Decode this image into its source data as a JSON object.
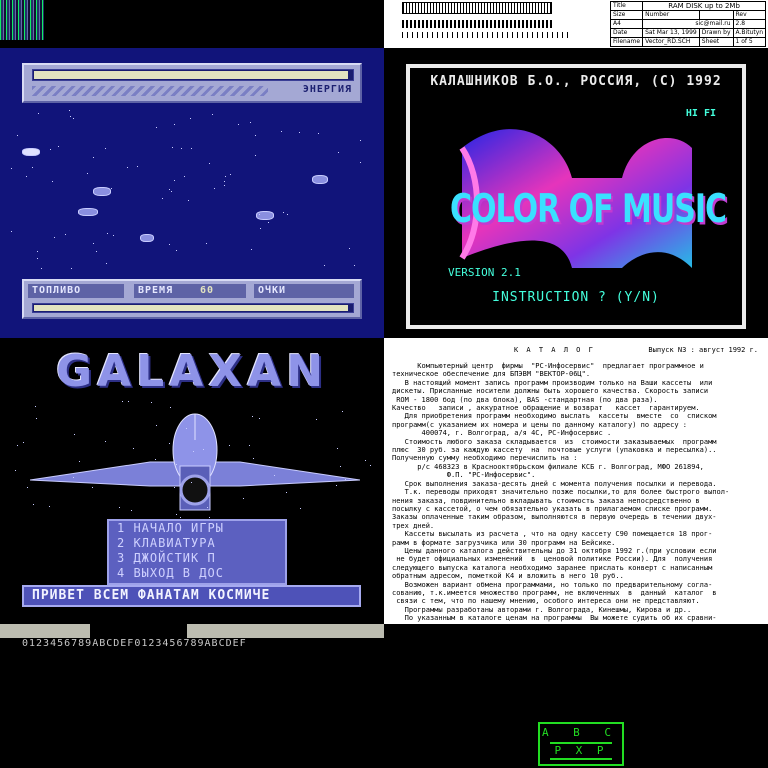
{
  "schematic": {
    "title_label": "Title",
    "title_value": "RAM DISK up to 2Mb",
    "size_label": "Size",
    "number_label": "Number",
    "rev_label": "Rev",
    "size_value": "A4",
    "number_value": "sic@mail.ru",
    "rev_value": "2.8",
    "date_label": "Date",
    "date_value": "Sat Mar 13, 1999",
    "drawn_label": "Drawn by",
    "drawn_value": "A.Bitutyn",
    "file_label": "Filename",
    "file_value": "Vector_RD.SCH",
    "sheet_label": "Sheet",
    "sheet_value": "1 of 5"
  },
  "game": {
    "energy_label": "ЭНЕРГИЯ",
    "fuel_label": "ТОПЛИВО",
    "time_label": "ВРЕМЯ",
    "time_value": "60",
    "score_label": "ОЧКИ",
    "energy_level": 0.98,
    "fuel_level": 0.98
  },
  "music": {
    "credit": "КАЛАШНИКОВ Б.О., РОССИЯ, (С) 1992",
    "hifi": "HI FI",
    "logo": "COLOR OF MUSIC",
    "version": "VERSION 2.1",
    "instruction": "INSTRUCTION ? (Y/N)"
  },
  "galaxan": {
    "title": "GALAXAN",
    "menu": [
      "1 НАЧАЛО ИГРЫ",
      "2 КЛАВИАТУРА",
      "3 ДЖОЙСТИК П",
      "4 ВЫХОД В ДОС"
    ],
    "ticker": "ПРИВЕТ ВСЕМ ФАНАТАМ КОСМИЧЕ"
  },
  "font_strip": "0123456789ABCDEF0123456789ABCDEF",
  "catalog": {
    "heading": "К А Т А Л О Г",
    "issue": "Выпуск N3 : август 1992 г.",
    "body": "      Компьютерный центр  фирмы  \"РС-Инфосервис\"  предлагает программное и\nтехническое обеспечение для БПЭВМ \"ВЕКТОР-06Ц\".\n   В настоящий момент запись программ производим только на Ваши кассеты  или\nдискеты. Присланные носители должны быть хорошего качества. Скорость записи\n ROM - 1800 бод (по два блока), BAS -стандартная (по два раза).\nКачество   записи , аккуратное обращение и возврат   кассет  гарантируем.\n   Для приобретения программ необходимо выслать  кассеты  вместе  со  списком\nпрограмм(с указанием их номера и цены по данному каталогу) по адресу :\n       400074, г. Волгоград, а/я 4С, РС-Инфосервис .\n   Стоимость любого заказа складывается  из  стоимости заказываемых  программ\nплюс  30 руб. за каждую кассету  на  почтовые услуги (упаковка и пересылка)..\nПолученную сумму необходимо перечислить на :\n      р/с 468323 в Краснооктябрьском филиале КСБ г. Волгоград, МФО 261894,\n             Ф.П. \"РС-Инфосервис\".\n   Срок выполнения заказа-десять дней с момента получения посылки и перевода.\n   Т.к. переводы приходят значительно позже посылки,то для более быстрого выпол-\nнения заказа, повдинительно вкладывать стоимость заказа непосредственно в\nпосылку с кассетой, о чем обязательно указать в прилагаемом списке программ.\nЗаказы оплаченные таким образом, выполняются в первую очередь в течении двух-\nтрех дней.\n   Кассеты высылать из расчета , что на одну кассету С90 помещается 18 прог-\nрамм в формате загрузчика или 30 программ на Бейсике.\n   Цены данного каталога действительны до 31 октября 1992 г.(при условии если\n не будет официальных изменений  в  ценовой политике России). Для  получения\nследующего выпуска каталога необходимо заранее прислать конверт с написанным\nобратным адресом, пометкой К4 и вложить в него 10 руб..\n   Возможен вариант обмена программами, но только по предварительному согла-\nсованию, т.к.имеется множество программ, не включенных  в  данный  каталог  в\n связи с тем, что по нашему мнению, особого интереса они не представляют.\n   Программы разработаны авторами г. Волгограда, Кинешмы, Кирова и др..\n   По указанным в каталоге ценам на программы  Вы можете судить об их сравни-"
  },
  "abc": {
    "row1": "A B C",
    "row2": "P X P"
  }
}
